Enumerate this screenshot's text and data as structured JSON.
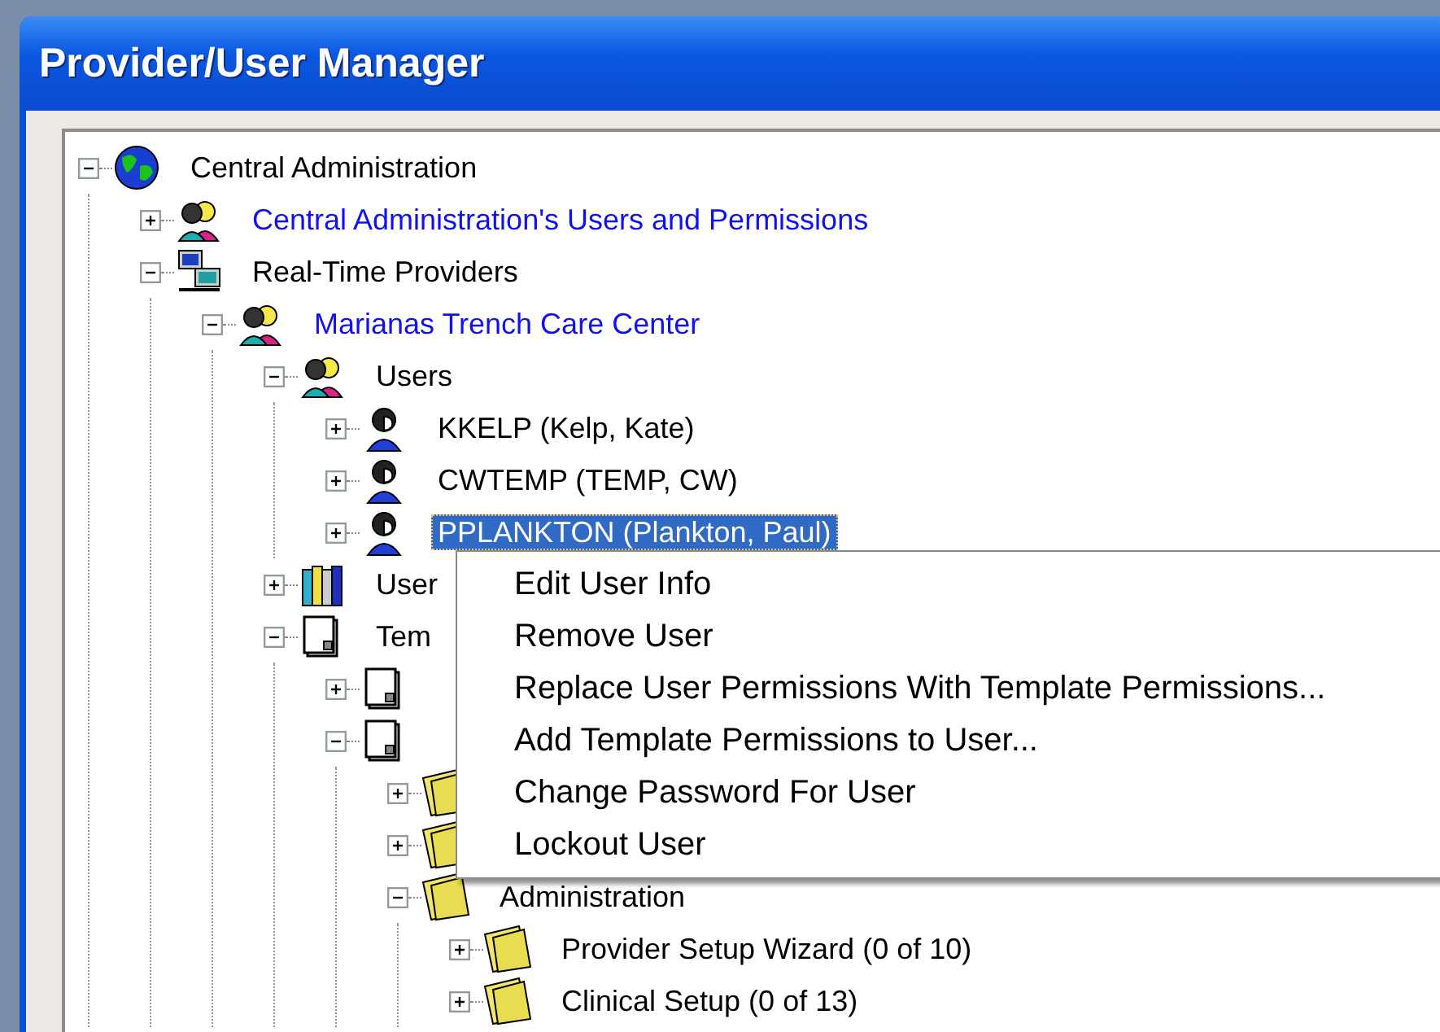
{
  "window": {
    "title": "Provider/User Manager"
  },
  "tree": [
    {
      "label": "Central Administration",
      "kind": "globe",
      "link": false,
      "selected": false,
      "expanded": true,
      "children": [
        {
          "label": "Central Administration's Users and Permissions",
          "kind": "group",
          "link": true,
          "selected": false,
          "expanded": false
        },
        {
          "label": "Real-Time Providers",
          "kind": "computers",
          "link": false,
          "selected": false,
          "expanded": true,
          "children": [
            {
              "label": "Marianas Trench Care Center",
              "kind": "group",
              "link": true,
              "selected": false,
              "expanded": true,
              "children": [
                {
                  "label": "Users",
                  "kind": "group",
                  "link": false,
                  "selected": false,
                  "expanded": true,
                  "children": [
                    {
                      "label": "KKELP (Kelp, Kate)",
                      "kind": "user",
                      "link": false,
                      "selected": false,
                      "expanded": false
                    },
                    {
                      "label": "CWTEMP (TEMP, CW)",
                      "kind": "user",
                      "link": false,
                      "selected": false,
                      "expanded": false
                    },
                    {
                      "label": "PPLANKTON (Plankton, Paul)",
                      "kind": "user",
                      "link": false,
                      "selected": true,
                      "expanded": false
                    }
                  ]
                },
                {
                  "label": "User",
                  "kind": "books",
                  "link": false,
                  "selected": false,
                  "expanded": false
                },
                {
                  "label": "Tem",
                  "kind": "document",
                  "link": false,
                  "selected": false,
                  "expanded": true,
                  "children": [
                    {
                      "kind": "document",
                      "expanded": false
                    },
                    {
                      "kind": "document",
                      "expanded": true,
                      "children": [
                        {
                          "kind": "folder",
                          "expanded": false
                        },
                        {
                          "kind": "folder",
                          "expanded": false
                        },
                        {
                          "label": "Administration",
                          "kind": "folder",
                          "link": false,
                          "selected": false,
                          "expanded": true,
                          "children": [
                            {
                              "label": "Provider Setup Wizard (0 of 10)",
                              "kind": "folder",
                              "link": false,
                              "selected": false,
                              "expanded": false
                            },
                            {
                              "label": "Clinical Setup (0 of 13)",
                              "kind": "folder",
                              "link": false,
                              "selected": false,
                              "expanded": false
                            }
                          ]
                        }
                      ]
                    }
                  ]
                }
              ]
            }
          ]
        }
      ]
    }
  ],
  "context_menu": {
    "items": [
      "Edit User Info",
      "Remove User",
      "Replace User Permissions With Template Permissions...",
      "Add Template Permissions to User...",
      "Change Password For User",
      "Lockout User"
    ]
  }
}
